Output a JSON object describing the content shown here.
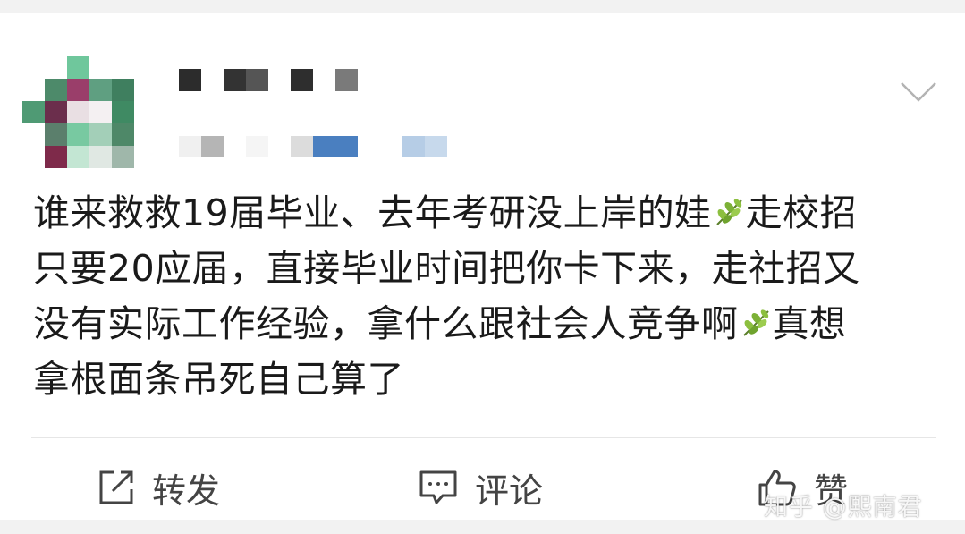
{
  "post": {
    "body_lines": [
      {
        "before": "谁来救救19届毕业、去年考研没上岸的娃",
        "after": "走校招"
      },
      {
        "before": "只要20应届，直接毕业时间把你卡下来，走社招又",
        "after": ""
      },
      {
        "before": "没有实际工作经验，拿什么跟社会人竞争啊",
        "after": "真想"
      },
      {
        "before": "拿根面条吊死自己算了",
        "after": ""
      }
    ],
    "emoji_icon": "leaf-icon"
  },
  "actions": {
    "repost_label": "转发",
    "comment_label": "评论",
    "like_label": "赞"
  },
  "watermark": {
    "text": "知乎 @熙南君"
  },
  "colors": {
    "card_bg": "#ffffff",
    "page_bg": "#f2f2f2",
    "text": "#1a1a1a",
    "action_text": "#444444"
  }
}
